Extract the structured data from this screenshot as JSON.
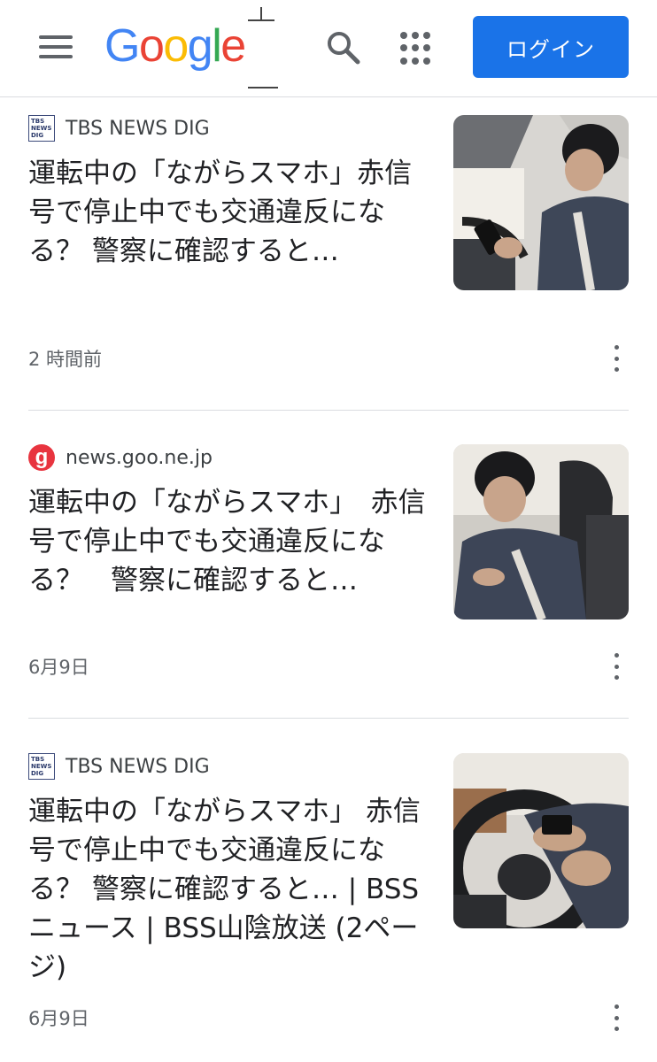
{
  "header": {
    "logo_letters": [
      "G",
      "o",
      "o",
      "g",
      "l",
      "e"
    ],
    "login_label": "ログイン",
    "menu_icon": "hamburger-menu-icon",
    "search_icon": "search-icon",
    "apps_icon": "apps-grid-icon",
    "colors": {
      "blue": "#4285f4",
      "red": "#ea4335",
      "yellow": "#fbbc05",
      "green": "#34a853",
      "login_bg": "#1a73e8"
    }
  },
  "articles": [
    {
      "source": "TBS NEWS DIG",
      "source_icon_text": [
        "TBS",
        "NEWS",
        "DIG"
      ],
      "title": "運転中の「ながらスマホ」赤信号で停止中でも交通違反になる？ 警察に確認すると…",
      "time": "2 時間前",
      "thumbnail": "driver-phone-photo"
    },
    {
      "source": "news.goo.ne.jp",
      "source_icon_text": [
        "g"
      ],
      "title": "運転中の「ながらスマホ」　赤信号で停止中でも交通違反になる？　警察に確認すると…",
      "time": "6月9日",
      "thumbnail": "driver-seat-photo"
    },
    {
      "source": "TBS NEWS DIG",
      "source_icon_text": [
        "TBS",
        "NEWS",
        "DIG"
      ],
      "title": "運転中の「ながらスマホ」 赤信号で停止中でも交通違反になる？ 警察に確認すると… | BSSニュース | BSS山陰放送 (2ページ)",
      "time": "6月9日",
      "thumbnail": "steering-wheel-photo"
    }
  ]
}
